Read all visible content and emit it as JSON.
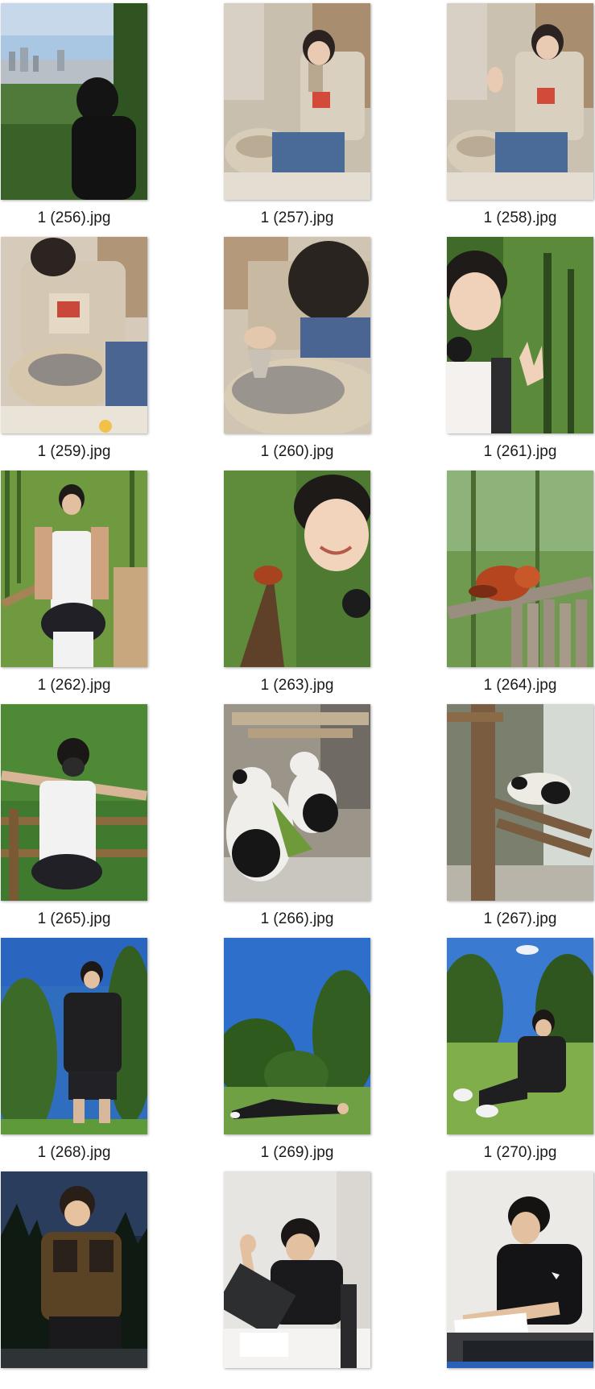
{
  "files": [
    {
      "name": "1 (256).jpg",
      "scene": "city-view"
    },
    {
      "name": "1 (257).jpg",
      "scene": "pottery-wave"
    },
    {
      "name": "1 (258).jpg",
      "scene": "pottery-wave"
    },
    {
      "name": "1 (259).jpg",
      "scene": "pottery-wheel"
    },
    {
      "name": "1 (260).jpg",
      "scene": "pottery-closeup"
    },
    {
      "name": "1 (261).jpg",
      "scene": "forest-selfie"
    },
    {
      "name": "1 (262).jpg",
      "scene": "bamboo-path"
    },
    {
      "name": "1 (263).jpg",
      "scene": "red-panda-selfie"
    },
    {
      "name": "1 (264).jpg",
      "scene": "red-panda"
    },
    {
      "name": "1 (265).jpg",
      "scene": "forest-stretch"
    },
    {
      "name": "1 (266).jpg",
      "scene": "giant-pandas"
    },
    {
      "name": "1 (267).jpg",
      "scene": "panda-resting"
    },
    {
      "name": "1 (268).jpg",
      "scene": "park-standing"
    },
    {
      "name": "1 (269).jpg",
      "scene": "lawn-lying"
    },
    {
      "name": "1 (270).jpg",
      "scene": "lawn-sitting"
    },
    {
      "name": "",
      "scene": "night-portrait"
    },
    {
      "name": "",
      "scene": "office-tablet"
    },
    {
      "name": "",
      "scene": "office-desk"
    }
  ]
}
